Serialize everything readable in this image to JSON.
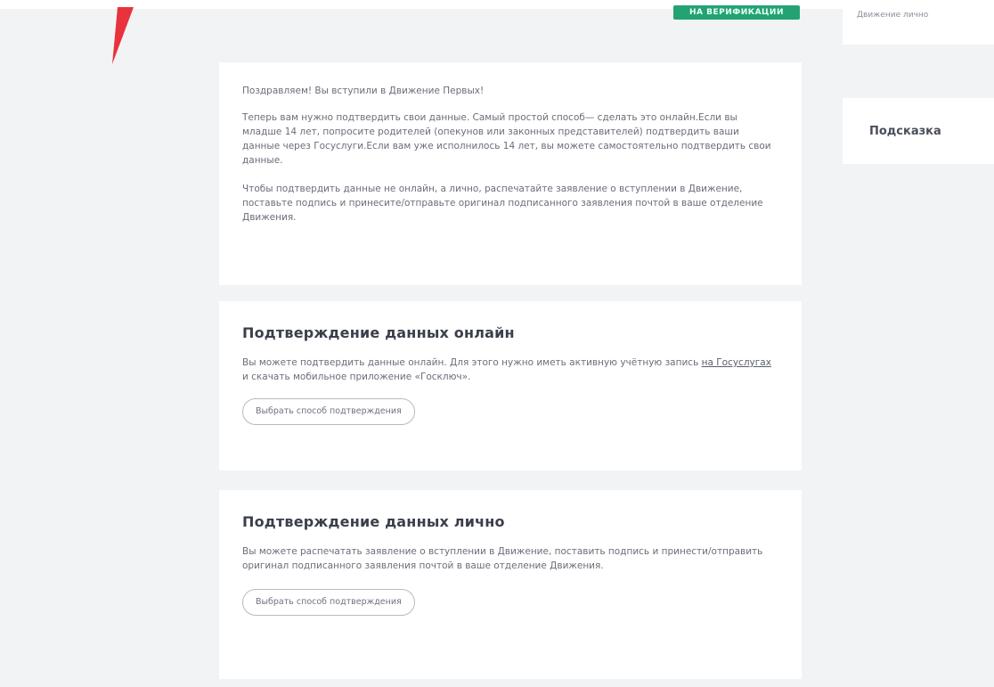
{
  "header": {
    "badge": "НА ВЕРИФИКАЦИИ",
    "side_top": "Движение лично"
  },
  "intro": {
    "p1": "Поздравляем! Вы вступили в Движение Первых!",
    "p2": "Теперь вам нужно подтвердить свои данные. Самый простой способ— сделать это онлайн.Если вы младше 14 лет, попросите родителей (опекунов или законных представителей) подтвердить ваши данные через Госуслуги.Если вам уже исполнилось 14 лет, вы можете самостоятельно подтвердить свои данные.",
    "p3": "Чтобы подтвердить данные не онлайн, а лично, распечатайте заявление о вступлении в Движение, поставьте подпись и принесите/отправьте оригинал подписанного заявления почтой в ваше отделение Движения."
  },
  "online": {
    "title": "Подтверждение данных онлайн",
    "text_a": "Вы можете подтвердить данные онлайн. Для этого нужно иметь активную учётную запись ",
    "link": "на Госуслугах",
    "text_b": " и скачать мобильное приложение «Госключ».",
    "button": "Выбрать способ подтверждения"
  },
  "person": {
    "title": "Подтверждение данных лично",
    "text": "Вы можете распечатать заявление о вступлении в Движение, поставить подпись и принести/отправить оригинал подписанного заявления почтой в ваше отделение Движения.",
    "button": "Выбрать способ подтверждения"
  },
  "sidebar": {
    "hint": "Подсказка"
  },
  "colors": {
    "badge": "#23a374",
    "flag": "#e8323c",
    "background": "#f2f3f5"
  }
}
